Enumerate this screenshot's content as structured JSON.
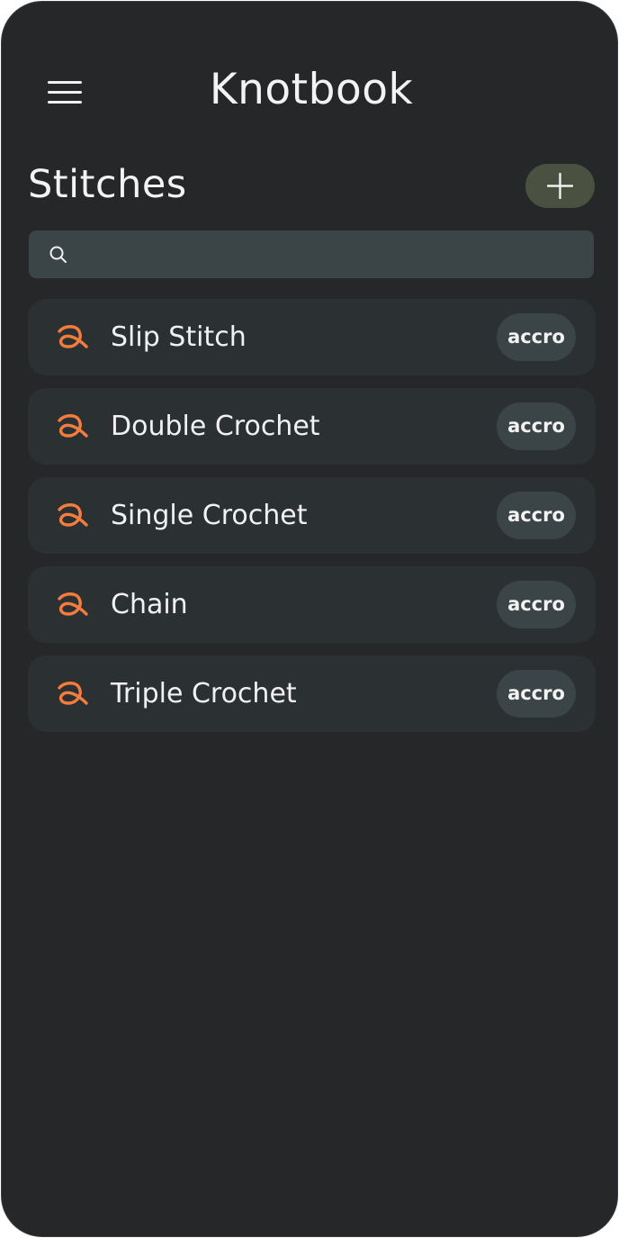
{
  "header": {
    "menu_icon": "hamburger-menu-icon",
    "title": "Knotbook"
  },
  "page": {
    "title": "Stitches",
    "add_icon": "plus-icon"
  },
  "search": {
    "icon": "search-icon",
    "placeholder": "",
    "value": ""
  },
  "stitches": [
    {
      "name": "Slip Stitch",
      "tag": "accro",
      "icon": "yarn-loop-icon"
    },
    {
      "name": "Double Crochet",
      "tag": "accro",
      "icon": "yarn-loop-icon"
    },
    {
      "name": "Single Crochet",
      "tag": "accro",
      "icon": "yarn-loop-icon"
    },
    {
      "name": "Chain",
      "tag": "accro",
      "icon": "yarn-loop-icon"
    },
    {
      "name": "Triple Crochet",
      "tag": "accro",
      "icon": "yarn-loop-icon"
    }
  ],
  "colors": {
    "background": "#262729",
    "card": "#2b3033",
    "accent_orange": "#f47c3c",
    "add_button": "#4b5141",
    "search_and_tag": "#3b4547"
  }
}
